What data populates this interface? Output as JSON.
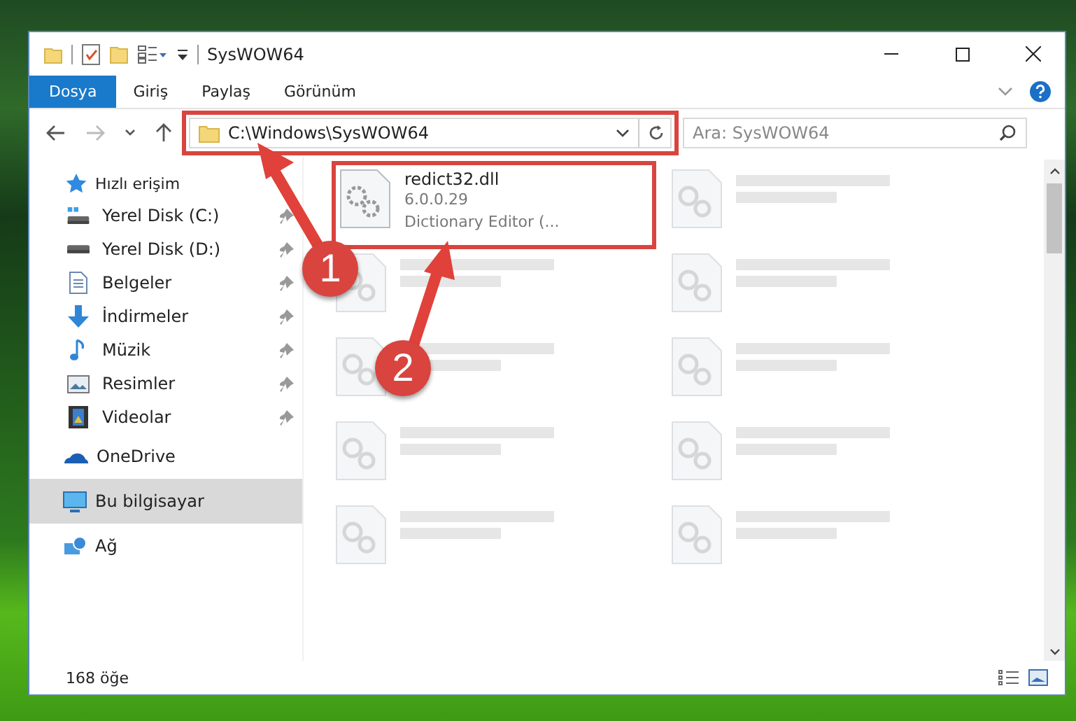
{
  "window": {
    "title": "SysWOW64"
  },
  "ribbon_tabs": [
    {
      "label": "Dosya",
      "selected": true
    },
    {
      "label": "Giriş",
      "selected": false
    },
    {
      "label": "Paylaş",
      "selected": false
    },
    {
      "label": "Görünüm",
      "selected": false
    }
  ],
  "address_bar": {
    "path": "C:\\Windows\\SysWOW64",
    "highlighted": true
  },
  "search": {
    "placeholder": "Ara: SysWOW64"
  },
  "sidebar": {
    "quick_access": {
      "label": "Hızlı erişim",
      "children": [
        {
          "label": "Yerel Disk (C:)",
          "pinned": true
        },
        {
          "label": "Yerel Disk (D:)",
          "pinned": true
        },
        {
          "label": "Belgeler",
          "pinned": true
        },
        {
          "label": "İndirmeler",
          "pinned": true
        },
        {
          "label": "Müzik",
          "pinned": true
        },
        {
          "label": "Resimler",
          "pinned": true
        },
        {
          "label": "Videolar",
          "pinned": true
        }
      ]
    },
    "items": [
      {
        "label": "OneDrive",
        "selected": false
      },
      {
        "label": "Bu bilgisayar",
        "selected": true
      },
      {
        "label": "Ağ",
        "selected": false
      }
    ]
  },
  "files": [
    {
      "name": "redict32.dll",
      "details": [
        "6.0.0.29",
        "Dictionary Editor (..."
      ],
      "faded": false,
      "highlighted": true
    },
    {
      "faded": true
    },
    {
      "faded": true
    },
    {
      "faded": true
    },
    {
      "faded": true
    },
    {
      "faded": true
    },
    {
      "faded": true
    },
    {
      "faded": true
    },
    {
      "faded": true
    },
    {
      "faded": true
    }
  ],
  "status_bar": {
    "item_count": "168 öğe"
  },
  "annotations": [
    {
      "number": "1"
    },
    {
      "number": "2"
    }
  ]
}
